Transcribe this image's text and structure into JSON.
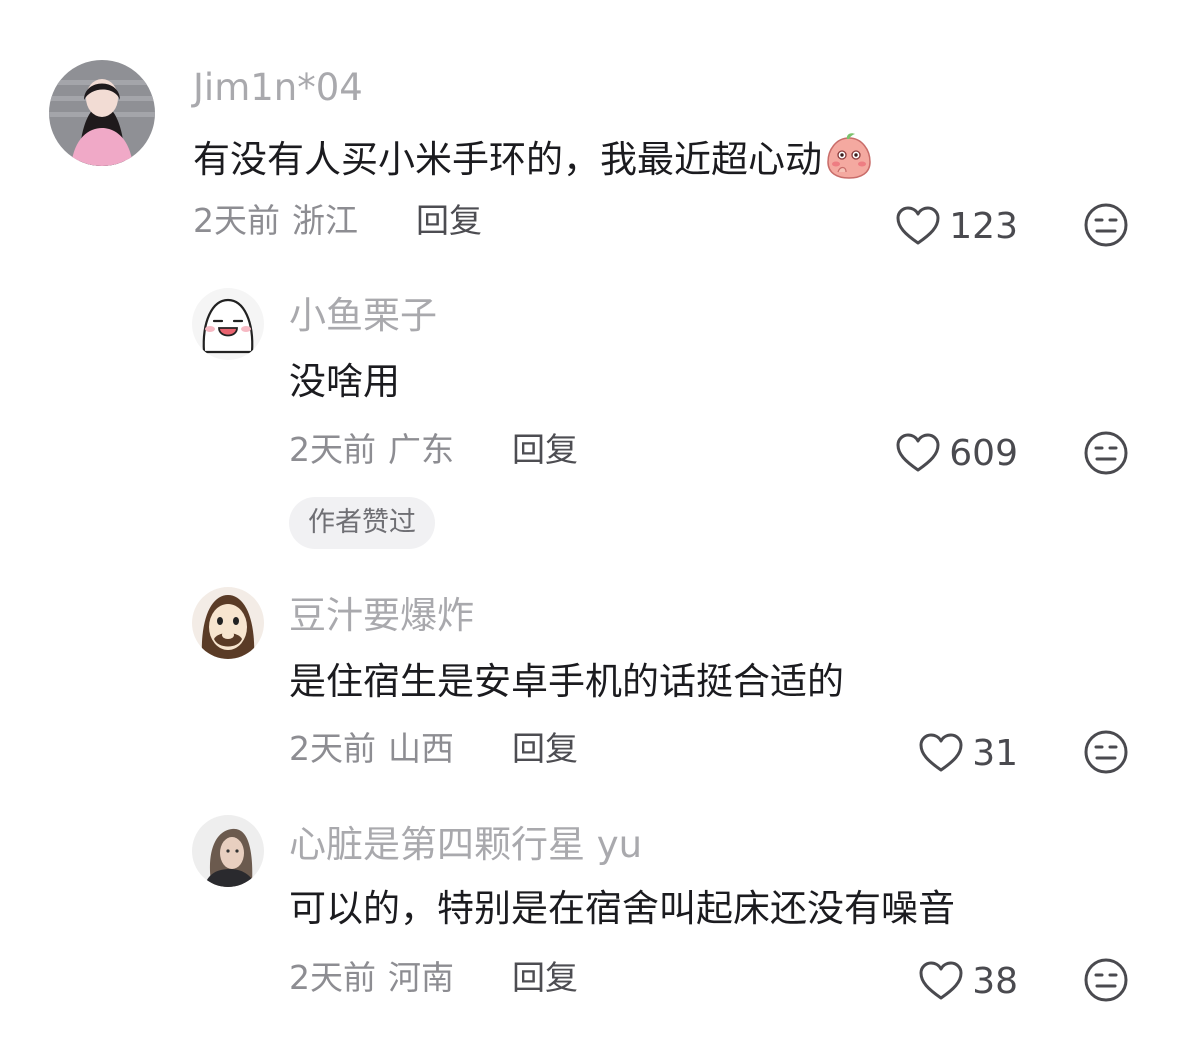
{
  "comments": [
    {
      "username": "Jim1n*04",
      "content": "有没有人买小米手环的，我最近超心动",
      "time": "2天前",
      "region": "浙江",
      "reply_label": "回复",
      "likes": "123",
      "content_emoji": "peach-shy-emoji"
    },
    {
      "username": "小鱼栗子",
      "content": "没啥用",
      "time": "2天前",
      "region": "广东",
      "reply_label": "回复",
      "likes": "609",
      "badge": "作者赞过"
    },
    {
      "username": "豆汁要爆炸",
      "content": "是住宿生是安卓手机的话挺合适的",
      "time": "2天前",
      "region": "山西",
      "reply_label": "回复",
      "likes": "31"
    },
    {
      "username": "心脏是第四颗行星 yu",
      "content": "可以的，特别是在宿舍叫起床还没有噪音",
      "time": "2天前",
      "region": "河南",
      "reply_label": "回复",
      "likes": "38"
    }
  ],
  "icons": {
    "like": "heart-outline-icon",
    "react": "neutral-face-icon"
  },
  "colors": {
    "username": "#a9a9ad",
    "content": "#1b1b1f",
    "meta": "#8d8d92",
    "badge_bg": "#f1f1f3"
  }
}
